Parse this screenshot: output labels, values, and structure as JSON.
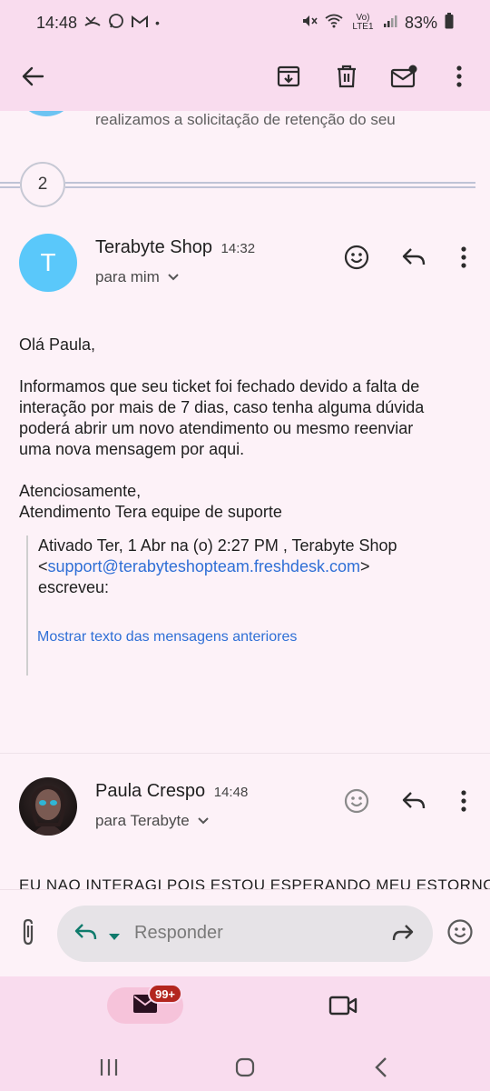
{
  "status_bar": {
    "time": "14:48",
    "dot": "•",
    "network": "Vo) LTE1",
    "battery": "83%",
    "icons": [
      "missed-call-icon",
      "whatsapp-icon",
      "gmail-icon",
      "mute-icon",
      "wifi-6-icon",
      "signal-icon",
      "battery-icon"
    ]
  },
  "toolbar": {
    "icons": [
      "back-arrow-icon",
      "archive-icon",
      "trash-icon",
      "mark-unread-icon",
      "more-vert-icon"
    ]
  },
  "thread": {
    "previous_snippet": "realizamos a solicitação de retenção do seu",
    "collapsed_count": "2",
    "messages": [
      {
        "avatar_letter": "T",
        "avatar_color": "#5ac8fa",
        "sender": "Terabyte Shop",
        "time": "14:32",
        "recipient": "para mim",
        "greeting": "Olá Paula,",
        "paragraph_lines": [
          "Informamos que seu ticket foi fechado devido a falta de",
          "interação por mais de 7 dias, caso tenha alguma dúvida",
          "poderá abrir um novo atendimento ou mesmo reenviar",
          "uma nova mensagem por aqui."
        ],
        "signoff_1": "Atenciosamente,",
        "signoff_2": "Atendimento Tera equipe de suporte",
        "quote": {
          "line1": "Ativado Ter, 1 Abr na (o) 2:27 PM , Terabyte Shop",
          "open_bracket": "<",
          "email": "support@terabyteshopteam.freshdesk.com",
          "close_bracket": ">",
          "line3": "escreveu:",
          "show_previous": "Mostrar texto das mensagens anteriores"
        }
      },
      {
        "sender": "Paula Crespo",
        "time": "14:48",
        "recipient": "para Terabyte",
        "body_cut": "EU NAO INTERAGI POIS ESTOU ESPERANDO MEU ESTORNO!!!"
      }
    ]
  },
  "reply": {
    "placeholder": "Responder"
  },
  "bottom_nav": {
    "mail_badge": "99+"
  },
  "colors": {
    "accent_link": "#2f6fd6",
    "badge": "#b3261e",
    "header_bg": "#f9dcee",
    "reply_icon": "#0f7b6c"
  }
}
